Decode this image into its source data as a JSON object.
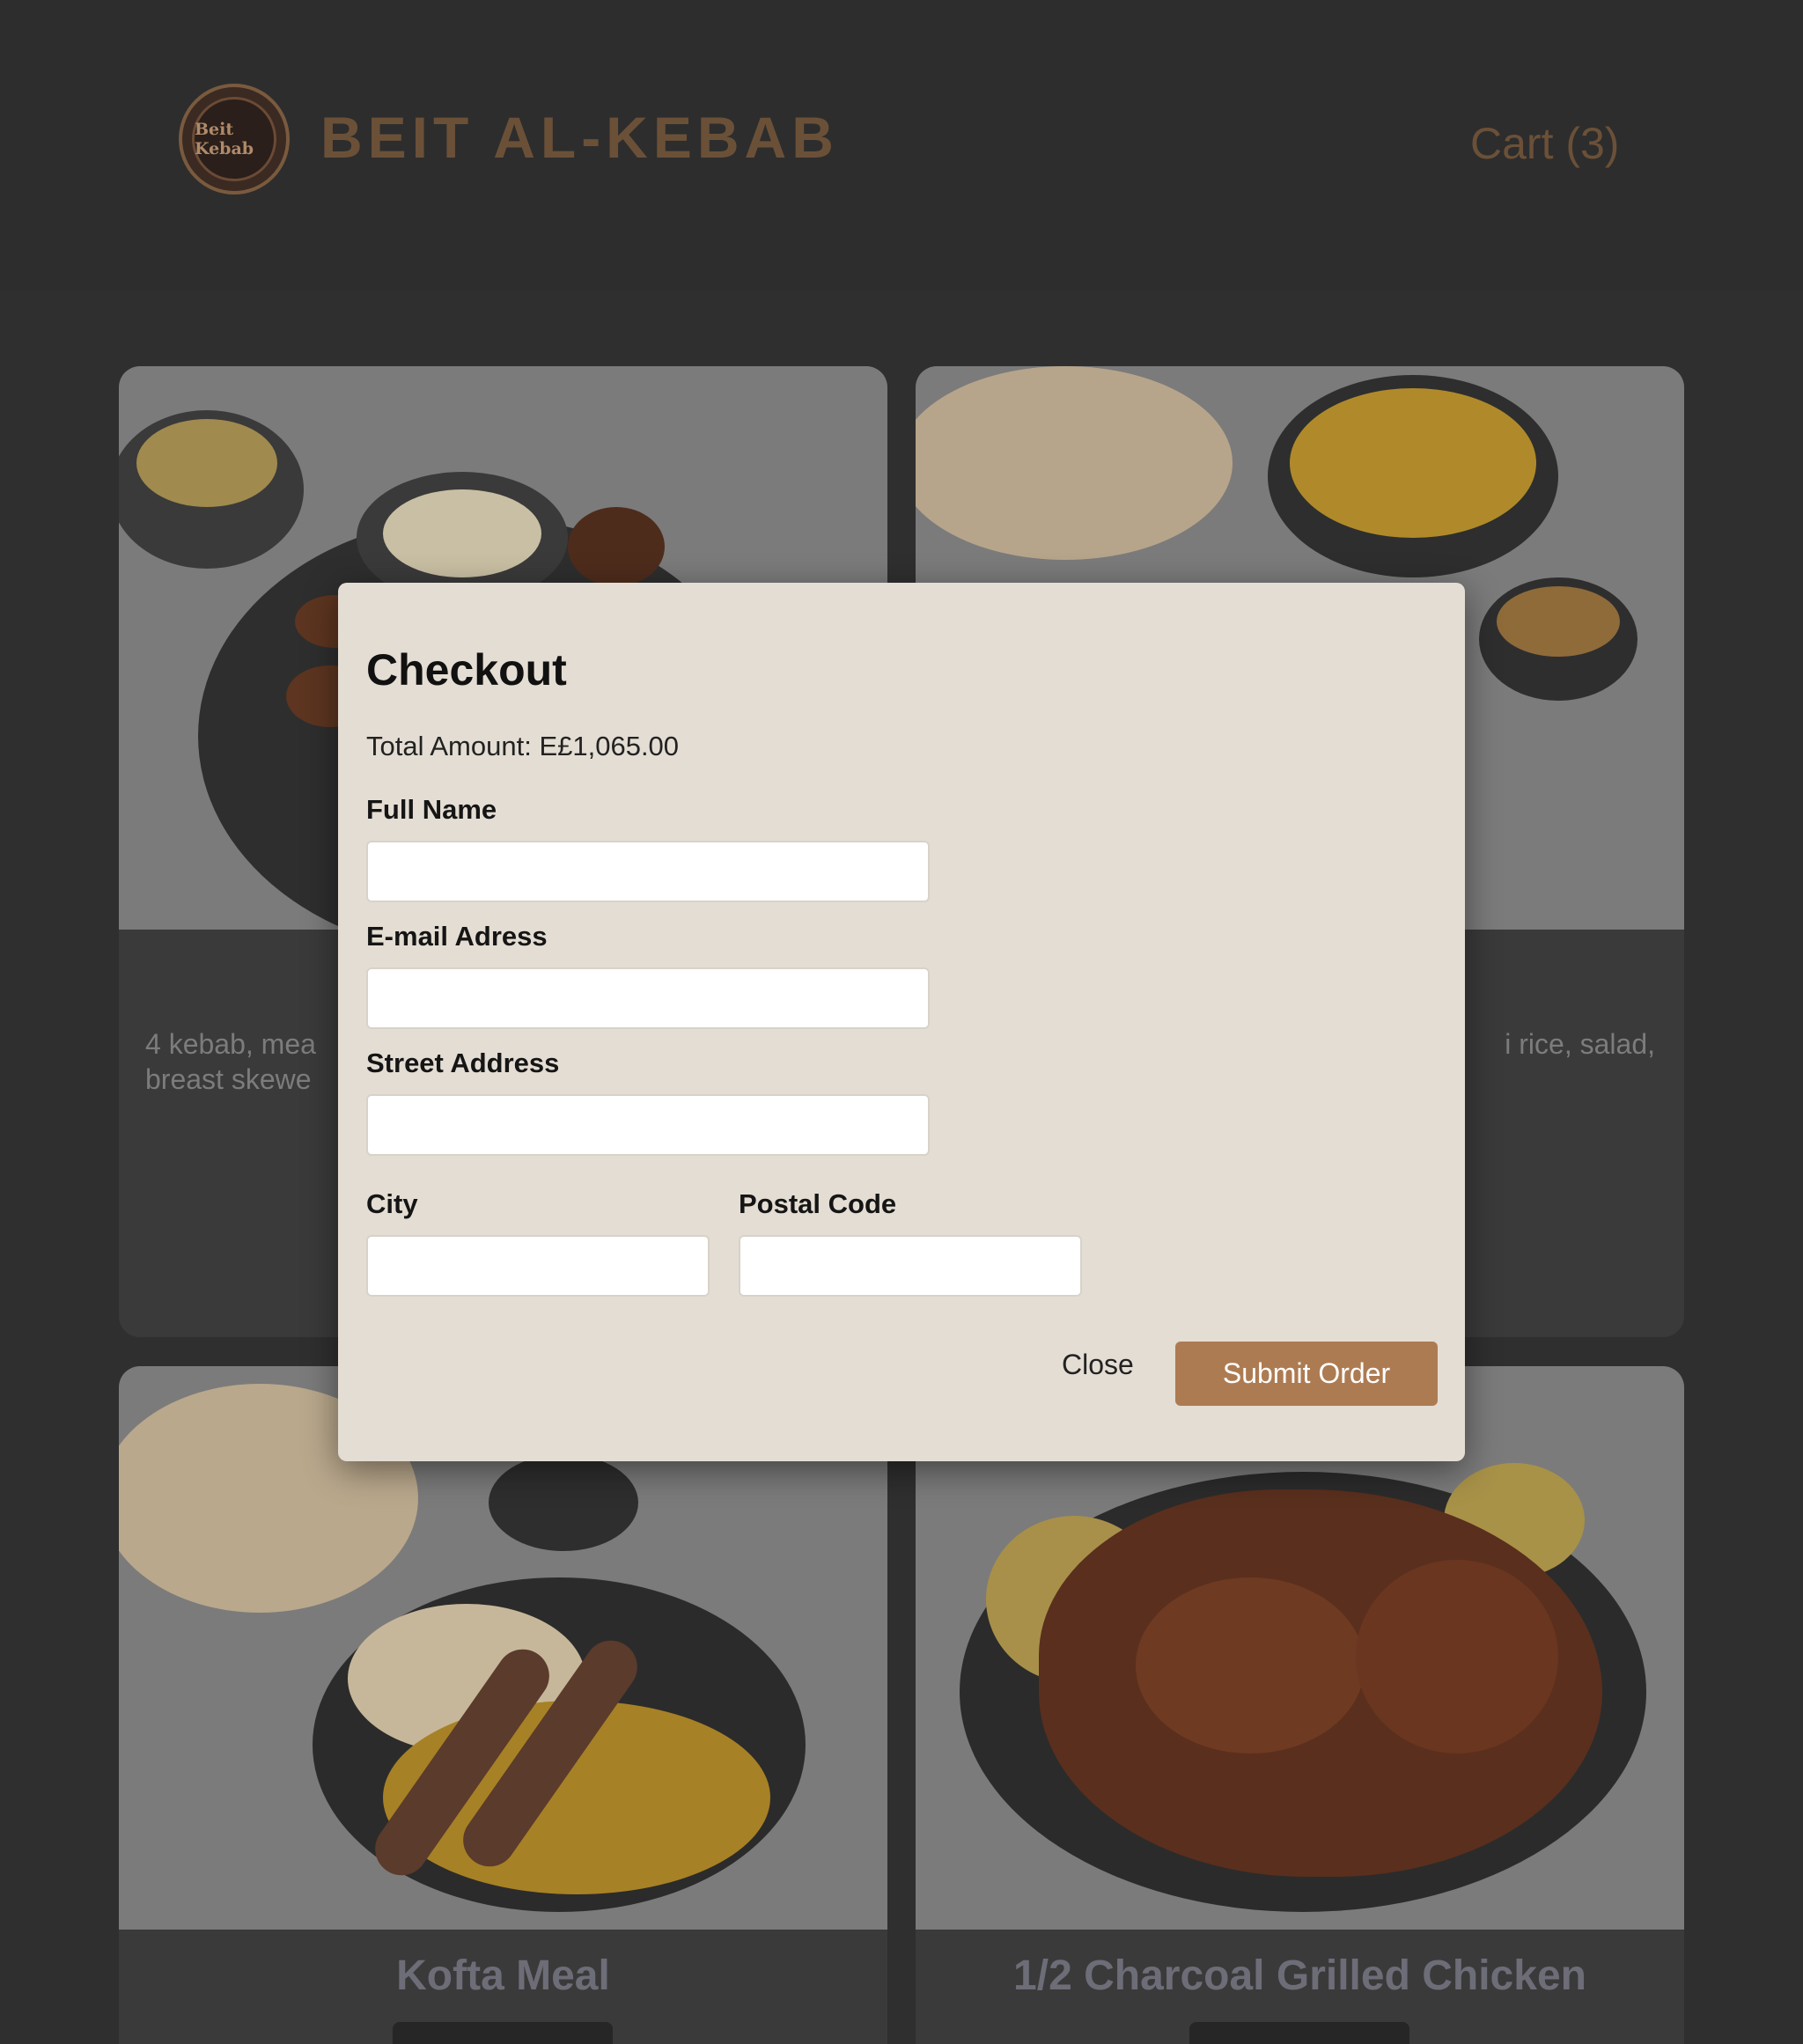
{
  "header": {
    "brand": "BEIT AL-KEBAB",
    "logo_text": "Beit Kebab",
    "cart_label": "Cart (3)"
  },
  "cards": {
    "top_left_desc": "4 kebab, mea\nbreast skewe",
    "top_right_desc": "i rice, salad,",
    "bottom_left_title": "Kofta Meal",
    "bottom_right_title": "1/2 Charcoal Grilled Chicken"
  },
  "modal": {
    "title": "Checkout",
    "total": "Total Amount: E£1,065.00",
    "full_name_label": "Full Name",
    "email_label": "E-mail Adress",
    "street_label": "Street Address",
    "city_label": "City",
    "postal_label": "Postal Code",
    "close_label": "Close",
    "submit_label": "Submit Order",
    "full_name_value": "",
    "email_value": "",
    "street_value": "",
    "city_value": "",
    "postal_value": ""
  },
  "colors": {
    "accent": "#ad7b52",
    "modal_bg": "#e4ddd3",
    "page_bg": "#2d2d2d"
  }
}
